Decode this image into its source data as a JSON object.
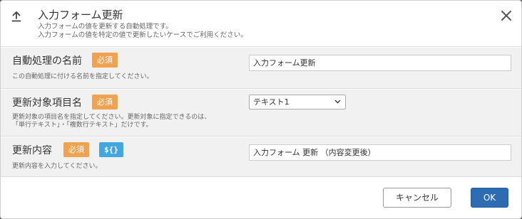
{
  "header": {
    "title": "入力フォーム更新",
    "desc_line1": "入力フォームの値を更新する自動処理です。",
    "desc_line2": "入力フォームの値を特定の値で更新したいケースでご利用ください。",
    "icon": "upload-icon",
    "close_icon": "close-icon"
  },
  "fields": [
    {
      "label": "自動処理の名前",
      "required_badge": "必須",
      "help": "この自動処理に付ける名前を指定してください。",
      "value": "入力フォーム更新"
    },
    {
      "label": "更新対象項目名",
      "required_badge": "必須",
      "help_line1": "更新対象の項目名を指定してください。更新対象に指定できるのは、",
      "help_line2": "「単行テキスト」・「複数行テキスト」だけです。",
      "selected": "テキスト1"
    },
    {
      "label": "更新内容",
      "required_badge": "必須",
      "var_badge": "${}",
      "help": "更新内容を入力してください。",
      "value": "入力フォーム 更新 （内容変更後）"
    }
  ],
  "footer": {
    "cancel_label": "キャンセル",
    "ok_label": "OK"
  },
  "colors": {
    "required": "#f0a250",
    "variable": "#42a6e0",
    "primary": "#2d6bb3"
  }
}
